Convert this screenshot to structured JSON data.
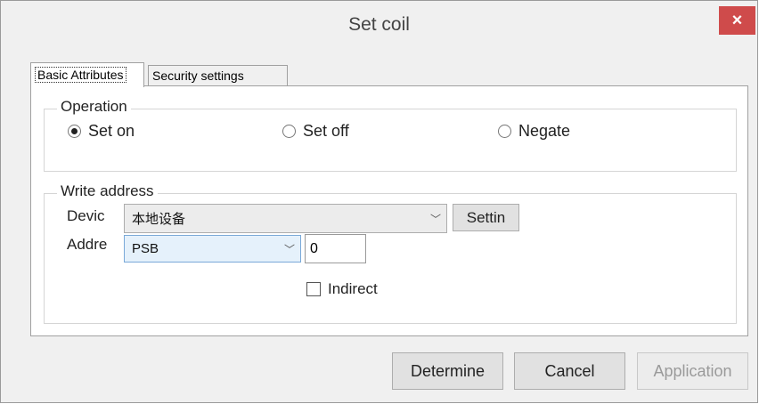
{
  "dialog": {
    "title": "Set coil",
    "close_label": "×"
  },
  "tabs": [
    {
      "label": "Basic Attributes",
      "active": true
    },
    {
      "label": "Security settings",
      "active": false
    }
  ],
  "operation": {
    "group_label": "Operation",
    "options": [
      {
        "label": "Set on",
        "selected": true
      },
      {
        "label": "Set off",
        "selected": false
      },
      {
        "label": "Negate",
        "selected": false
      }
    ]
  },
  "write_address": {
    "group_label": "Write address",
    "device_label": "Devic",
    "device_value": "本地设备",
    "setting_button": "Settin",
    "address_label": "Addre",
    "address_type": "PSB",
    "address_value": "0",
    "indirect_label": "Indirect",
    "indirect_checked": false
  },
  "footer": {
    "determine": "Determine",
    "cancel": "Cancel",
    "application": "Application"
  }
}
